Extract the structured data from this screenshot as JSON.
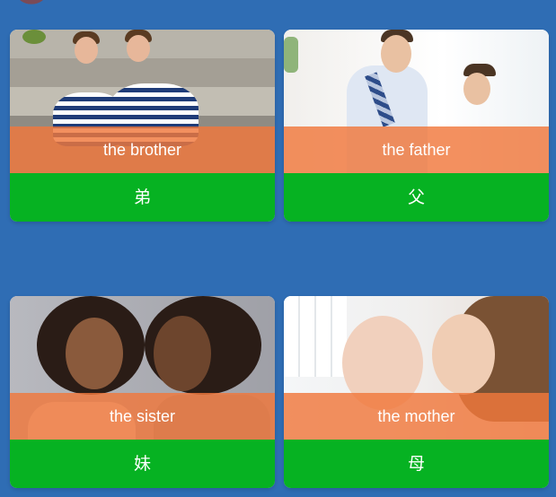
{
  "cards": [
    {
      "label": "the brother",
      "answer": "弟"
    },
    {
      "label": "the father",
      "answer": "父"
    },
    {
      "label": "the sister",
      "answer": "妹"
    },
    {
      "label": "the mother",
      "answer": "母"
    }
  ],
  "colors": {
    "background": "#2f6db4",
    "label_overlay": "#f0783c",
    "answer_bar": "#06b222"
  }
}
